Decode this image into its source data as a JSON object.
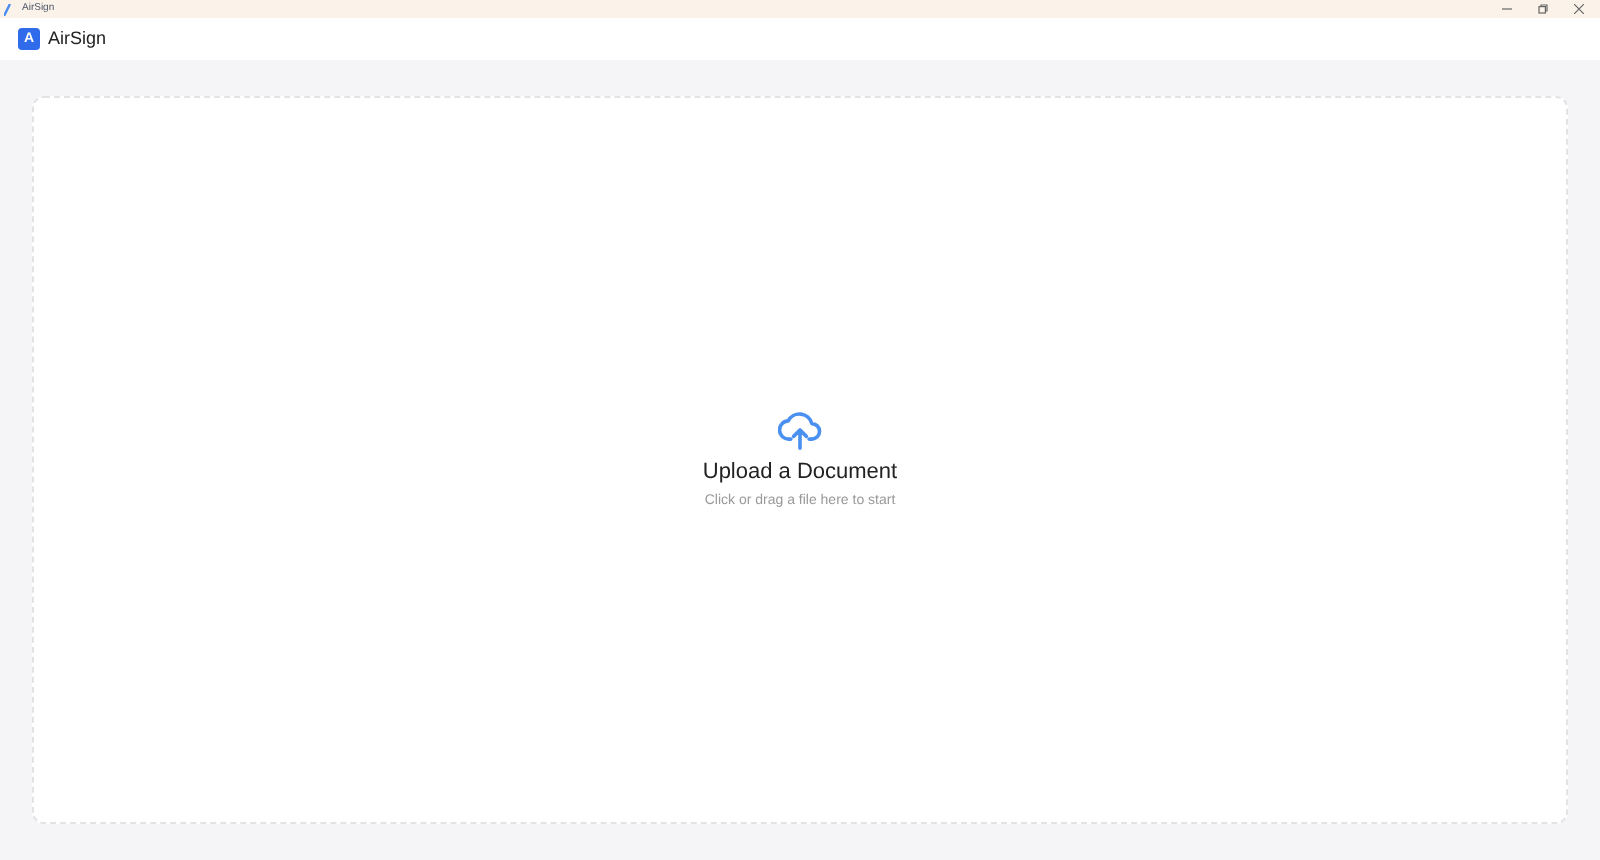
{
  "window": {
    "title": "AirSign"
  },
  "app": {
    "logo_letter": "A",
    "name": "AirSign"
  },
  "upload": {
    "title": "Upload a Document",
    "hint": "Click or drag a file here to start"
  }
}
